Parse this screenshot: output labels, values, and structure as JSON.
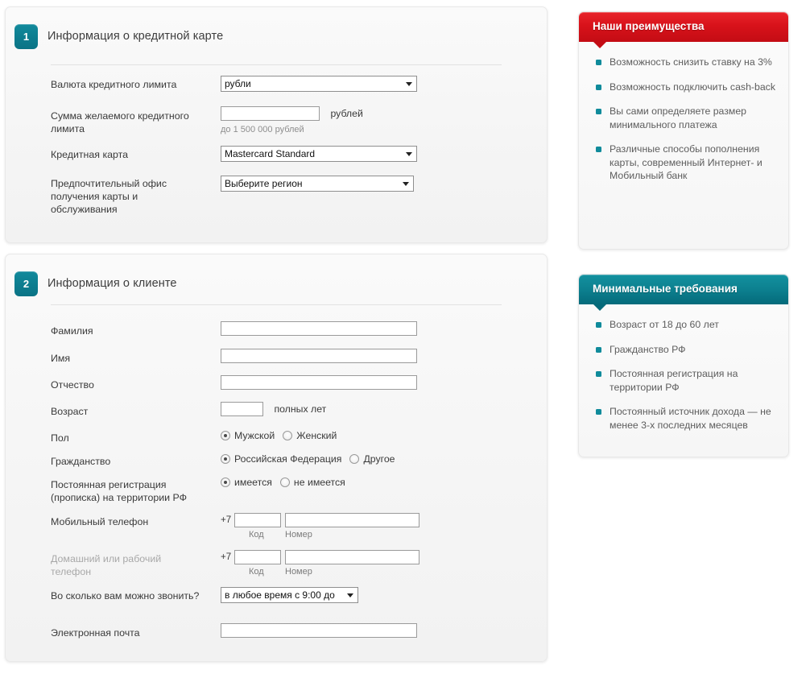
{
  "sections": [
    {
      "step": "1",
      "title": "Информация о кредитной карте",
      "fields": {
        "currency_label": "Валюта кредитного лимита",
        "currency_value": "рубли",
        "amount_label": "Сумма желаемого кредитного лимита",
        "amount_value": "",
        "amount_suffix": "рублей",
        "amount_hint": "до 1 500 000 рублей",
        "card_label": "Кредитная карта",
        "card_value": "Mastercard Standard",
        "office_label": "Предпочтительный офис получения карты и обслуживания",
        "office_value": "Выберите регион"
      }
    },
    {
      "step": "2",
      "title": "Информация о клиенте",
      "fields": {
        "lastname_label": "Фамилия",
        "lastname_value": "",
        "firstname_label": "Имя",
        "firstname_value": "",
        "patronymic_label": "Отчество",
        "patronymic_value": "",
        "age_label": "Возраст",
        "age_value": "",
        "age_suffix": "полных лет",
        "gender_label": "Пол",
        "gender_options": [
          "Мужской",
          "Женский"
        ],
        "gender_selected": 0,
        "citizenship_label": "Гражданство",
        "citizenship_options": [
          "Российская Федерация",
          "Другое"
        ],
        "citizenship_selected": 0,
        "registration_label": "Постоянная регистрация (прописка) на территории РФ",
        "registration_options": [
          "имеется",
          "не имеется"
        ],
        "registration_selected": 0,
        "mobile_label": "Мобильный телефон",
        "mobile_prefix": "+7",
        "mobile_code_value": "",
        "mobile_number_value": "",
        "mobile_code_sub": "Код",
        "mobile_number_sub": "Номер",
        "homephone_label": "Домашний или рабочий телефон",
        "homephone_prefix": "+7",
        "homephone_code_value": "",
        "homephone_number_value": "",
        "homephone_code_sub": "Код",
        "homephone_number_sub": "Номер",
        "calltime_label": "Во сколько вам можно звонить?",
        "calltime_value": "в любое время с 9:00 до ",
        "email_label": "Электронная почта",
        "email_value": ""
      }
    }
  ],
  "sidebar": {
    "advantages": {
      "title": "Наши преимущества",
      "items": [
        "Возможность снизить ставку на 3%",
        "Возможность подключить cash-back",
        "Вы сами определяете размер минимального платежа",
        "Различные способы пополнения карты, современный Интернет- и Мобильный банк"
      ]
    },
    "requirements": {
      "title": "Минимальные требования",
      "items": [
        "Возраст от 18 до 60 лет",
        "Гражданство РФ",
        "Постоянная регистрация на территории РФ",
        "Постоянный источник дохода — не менее 3-х последних месяцев"
      ]
    }
  },
  "colors": {
    "teal": "#0d8190",
    "red": "#d8121a",
    "bullet": "#108b9b",
    "label_text": "#3a3a3a",
    "dim_label_text": "#a9a9a9"
  }
}
